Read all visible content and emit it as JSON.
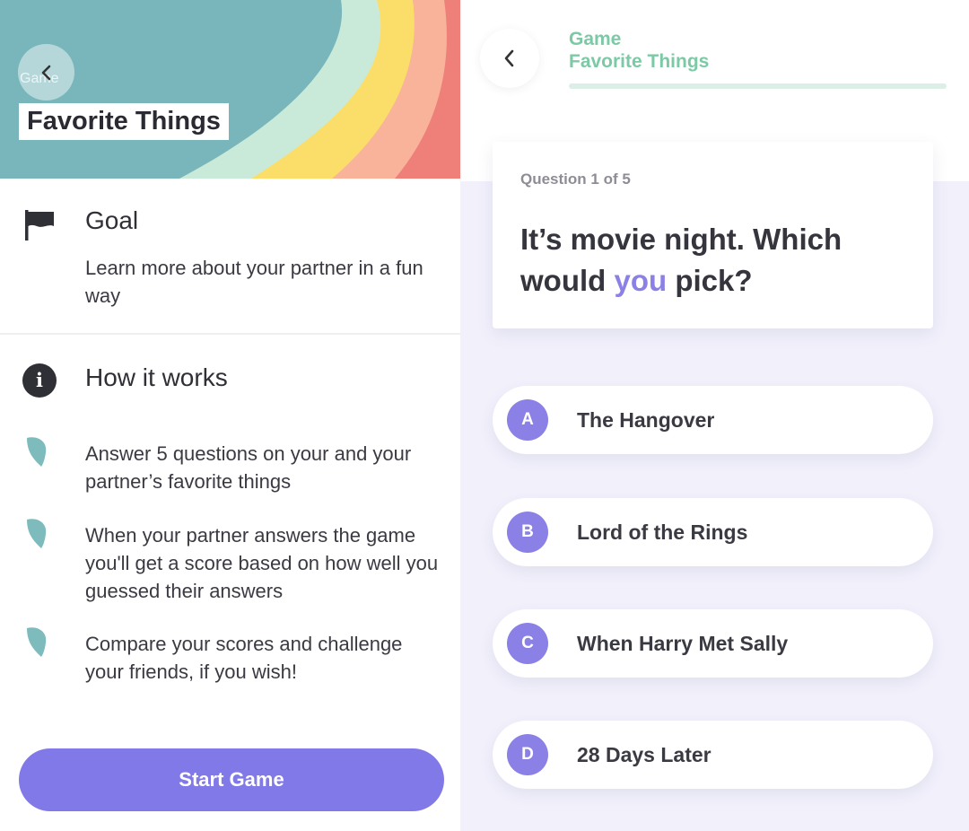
{
  "intro": {
    "hero": {
      "ghost_label": "Game",
      "title": "Favorite Things",
      "stripe_colors": [
        "#78b6bb",
        "#c9ead9",
        "#fbdd6a",
        "#f8b39a",
        "#ef8079"
      ]
    },
    "goal": {
      "icon": "flag-icon",
      "heading": "Goal",
      "text": "Learn more about your partner in a fun way"
    },
    "how_it_works": {
      "icon": "info-icon",
      "glyph": "i",
      "heading": "How it works",
      "bullet_icon": "leaf-icon",
      "bullet_color": "#7dbbbd",
      "steps": [
        {
          "text": "Answer 5 questions on your and your partner’s favorite things"
        },
        {
          "text": "When your partner answers the game you'll get a score based on how well you guessed their answers"
        },
        {
          "text": "Compare your scores and challenge your friends, if you wish!"
        }
      ]
    },
    "start_button": {
      "label": "Start Game",
      "color": "#8279e8"
    }
  },
  "quiz": {
    "header": {
      "back_icon": "chevron-left-icon",
      "crumb": "Game",
      "title": "Favorite Things",
      "accent": "#7cc9a6"
    },
    "question": {
      "counter": "Question 1 of 5",
      "text_before": "It’s movie night. Which would ",
      "text_highlight": "you",
      "text_after": " pick?",
      "highlight_color": "#8b80e6"
    },
    "options": [
      {
        "letter": "A",
        "label": "The Hangover"
      },
      {
        "letter": "B",
        "label": "Lord of the Rings"
      },
      {
        "letter": "C",
        "label": "When Harry Met Sally"
      },
      {
        "letter": "D",
        "label": "28 Days Later"
      }
    ]
  }
}
